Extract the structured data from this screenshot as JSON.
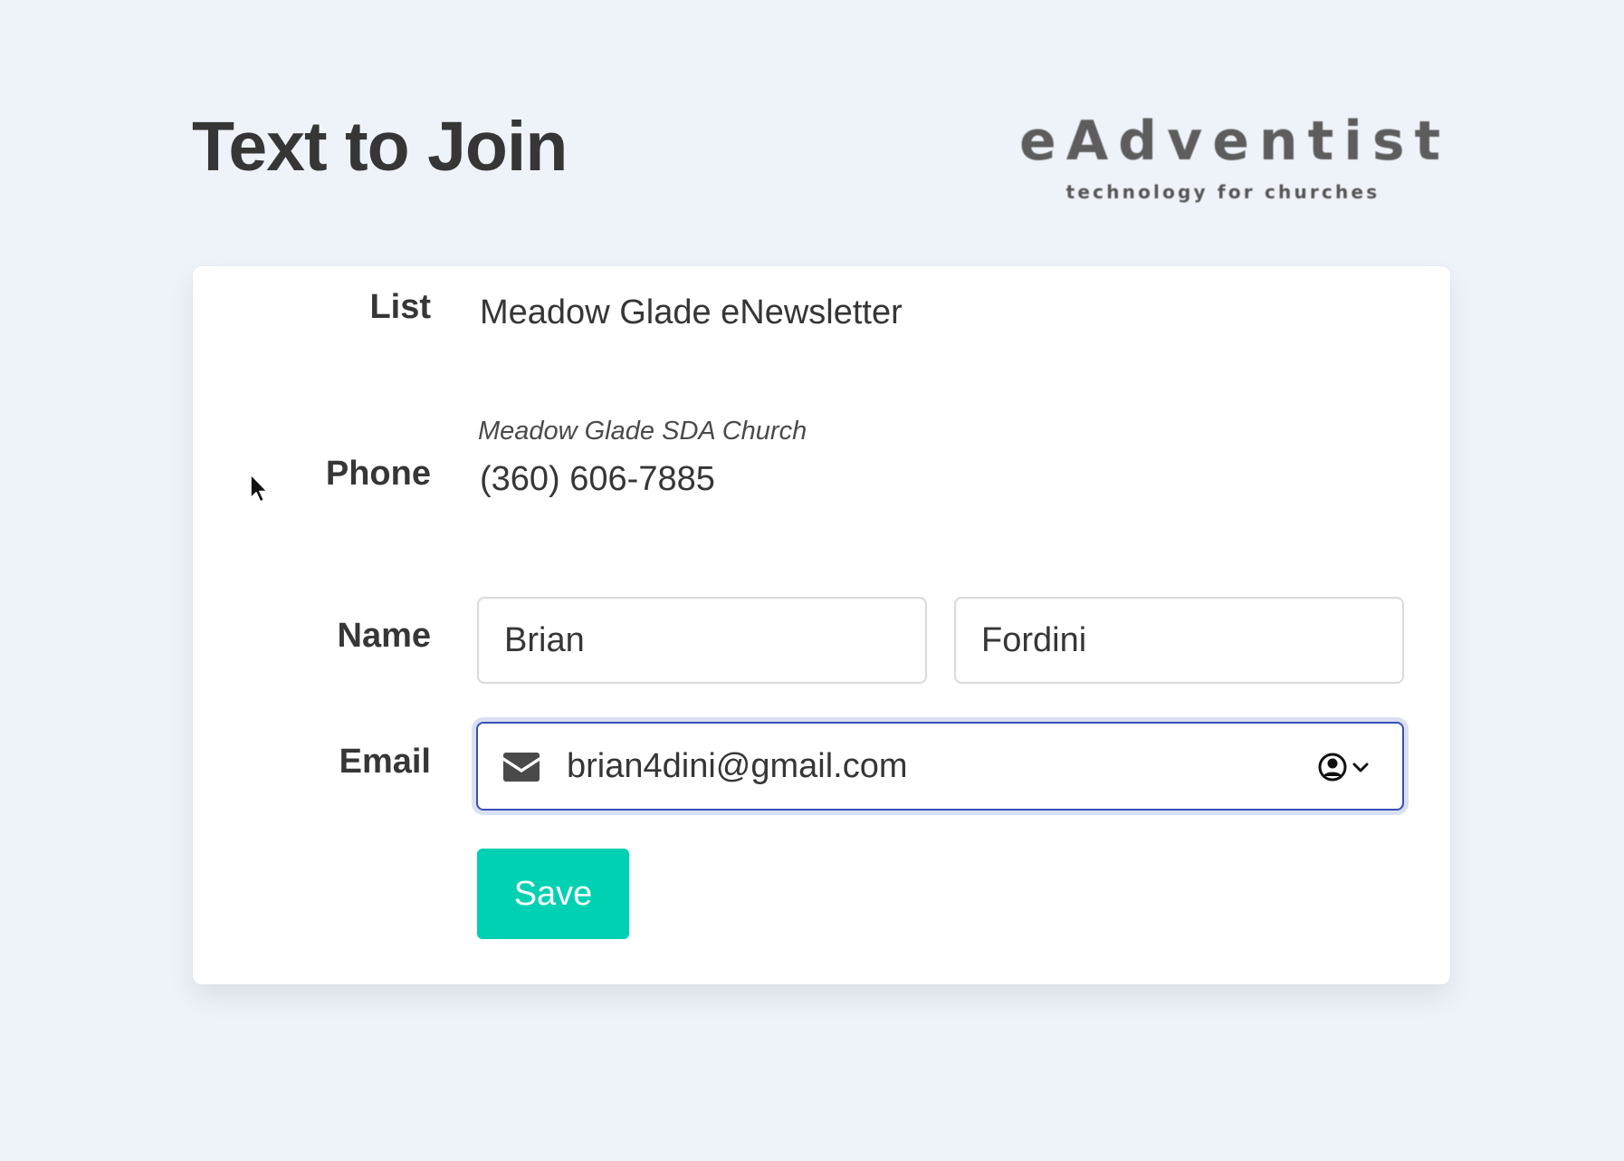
{
  "header": {
    "title": "Text to Join"
  },
  "logo": {
    "name": "eAdventist",
    "tagline": "technology for churches"
  },
  "form": {
    "list": {
      "label": "List",
      "value": "Meadow Glade eNewsletter",
      "organization": "Meadow Glade SDA Church"
    },
    "phone": {
      "label": "Phone",
      "value": "(360) 606-7885"
    },
    "name": {
      "label": "Name",
      "first_value": "Brian",
      "last_value": "Fordini"
    },
    "email": {
      "label": "Email",
      "value": "brian4dini@gmail.com",
      "icon": "envelope-icon",
      "autofill_icon": "person-circle-icon"
    },
    "save_label": "Save"
  },
  "colors": {
    "background": "#eef3fa",
    "card": "#ffffff",
    "text": "#363636",
    "accent_button": "#00d1b2",
    "focus_border": "#3850b7"
  }
}
